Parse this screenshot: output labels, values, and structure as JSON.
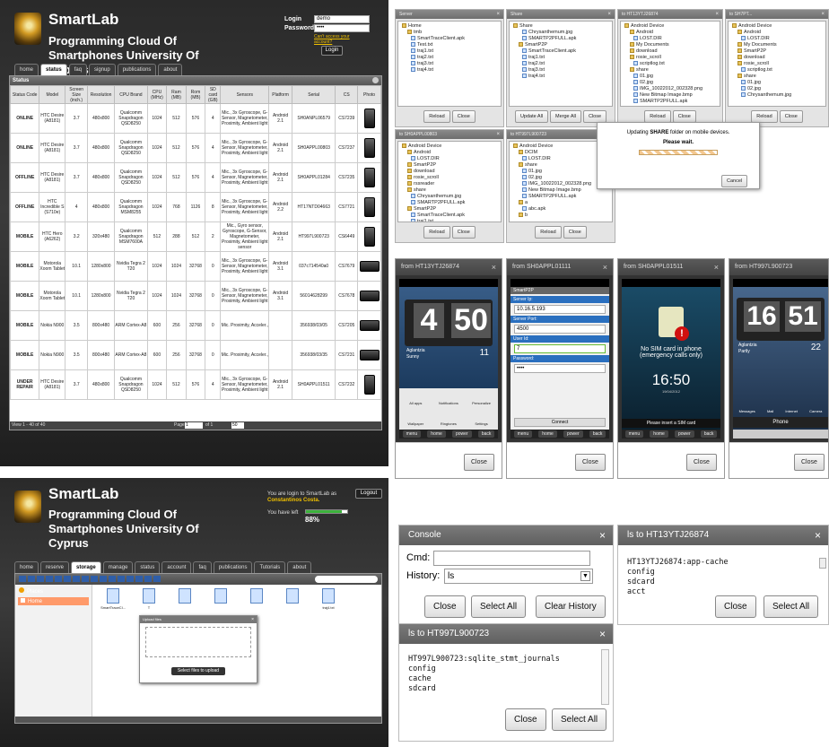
{
  "p1": {
    "app_title": "SmartLab",
    "subtitle": "Programming Cloud Of Smartphones University Of Cyprus",
    "login_label": "Login",
    "login_value": "demo",
    "password_label": "Password",
    "password_value": "••••",
    "access_link": "Can't access your account?",
    "login_button": "Login",
    "tabs": [
      "home",
      "status",
      "faq",
      "signup",
      "publications",
      "about"
    ],
    "panel_title": "Status",
    "columns": [
      "Status Code",
      "Model",
      "Screen Size (inch.)",
      "Resolution",
      "CPU Brand",
      "CPU (MHz)",
      "Ram (MB)",
      "Rom (MB)",
      "SD card (GB)",
      "Sensors",
      "Platform",
      "Serial",
      "CS",
      "Photo"
    ],
    "rows": [
      {
        "status": "ONLINE",
        "model": "HTC Desire (A8181)",
        "size": "3.7",
        "res": "480x800",
        "cpu": "Qualcomm Snapdragon QSD8250",
        "mhz": "1024",
        "ram": "512",
        "rom": "576",
        "sd": "4",
        "sensors": "Mic., 3x Gyroscope, G-Sensor, Magnetometer, Proximity, Ambient light",
        "platform": "Android 2.1",
        "serial": "SH0ANPL06579",
        "cs": "CS7239",
        "photo": "phone"
      },
      {
        "status": "ONLINE",
        "model": "HTC Desire (A8181)",
        "size": "3.7",
        "res": "480x800",
        "cpu": "Qualcomm Snapdragon QSD8250",
        "mhz": "1024",
        "ram": "512",
        "rom": "576",
        "sd": "4",
        "sensors": "Mic., 3x Gyroscope, G-Sensor, Magnetometer, Proximity, Ambient light",
        "platform": "Android 2.1",
        "serial": "SH0APPL00803",
        "cs": "CS7237",
        "photo": "phone"
      },
      {
        "status": "OFFLINE",
        "model": "HTC Desire (A8181)",
        "size": "3.7",
        "res": "480x800",
        "cpu": "Qualcomm Snapdragon QSD8250",
        "mhz": "1024",
        "ram": "512",
        "rom": "576",
        "sd": "4",
        "sensors": "Mic., 3x Gyroscope, G-Sensor, Magnetometer, Proximity, Ambient light",
        "platform": "Android 2.1",
        "serial": "SH0APPL01284",
        "cs": "CS7235",
        "photo": "phone"
      },
      {
        "status": "OFFLINE",
        "model": "HTC Incredible S (S710e)",
        "size": "4",
        "res": "480x800",
        "cpu": "Qualcomm Snapdragon MSM8255",
        "mhz": "1024",
        "ram": "768",
        "rom": "1126",
        "sd": "8",
        "sensors": "Mic., 3x Gyroscope, G-Sensor, Magnetometer, Proximity, Ambient light",
        "platform": "Android 2.2",
        "serial": "HT17NTD04663",
        "cs": "CS7721",
        "photo": "phone"
      },
      {
        "status": "MOBILE",
        "model": "HTC Hero (A6262)",
        "size": "3.2",
        "res": "320x480",
        "cpu": "Qualcomm Snapdragon MSM7600A",
        "mhz": "512",
        "ram": "288",
        "rom": "512",
        "sd": "2",
        "sensors": "Mic., Gyro sensor, Gyroscope, G-Sensor, Magnetometer, Proximity, Ambient light sensor",
        "platform": "Android 2.1",
        "serial": "HT997L900723",
        "cs": "CS6449",
        "photo": "phone"
      },
      {
        "status": "MOBILE",
        "model": "Motorola Xoom Tablet",
        "size": "10.1",
        "res": "1280x800",
        "cpu": "Nvidia Tegra 2 T20",
        "mhz": "1024",
        "ram": "1024",
        "rom": "32768",
        "sd": "0",
        "sensors": "Mic., 3x Gyroscope, G-Sensor, Magnetometer, Proximity, Ambient light",
        "platform": "Android 3.1",
        "serial": "037c714540a0",
        "cs": "CS7679",
        "photo": "tablet"
      },
      {
        "status": "MOBILE",
        "model": "Motorola Xoom Tablet",
        "size": "10.1",
        "res": "1280x800",
        "cpu": "Nvidia Tegra 2 T20",
        "mhz": "1024",
        "ram": "1024",
        "rom": "32768",
        "sd": "0",
        "sensors": "Mic., 3x Gyroscope, G-Sensor, Magnetometer, Proximity, Ambient light",
        "platform": "Android 3.1",
        "serial": "56014628299",
        "cs": "CS7678",
        "photo": "tablet"
      },
      {
        "status": "MOBILE",
        "model": "Nokia N900",
        "size": "3.5",
        "res": "800x480",
        "cpu": "ARM Cortex-A8",
        "mhz": "600",
        "ram": "256",
        "rom": "32768",
        "sd": "0",
        "sensors": "Mic. Proximity, Acceler.,",
        "platform": "",
        "serial": "356938/03/05",
        "cs": "CS7205",
        "photo": "tablet"
      },
      {
        "status": "MOBILE",
        "model": "Nokia N900",
        "size": "3.5",
        "res": "800x480",
        "cpu": "ARM Cortex-A8",
        "mhz": "600",
        "ram": "256",
        "rom": "32768",
        "sd": "0",
        "sensors": "Mic. Proximity, Acceler.,",
        "platform": "",
        "serial": "356938/03/35",
        "cs": "CS7231",
        "photo": "tablet"
      },
      {
        "status": "UNDER REPAIR",
        "model": "HTC Desire (A8181)",
        "size": "3.7",
        "res": "480x800",
        "cpu": "Qualcomm Snapdragon QSD8250",
        "mhz": "1024",
        "ram": "512",
        "rom": "576",
        "sd": "4",
        "sensors": "Mic., 3x Gyroscope, G-Sensor, Magnetometer, Proximity, Ambient light",
        "platform": "Android 2.1",
        "serial": "SH0APPL01511",
        "cs": "CS7232",
        "photo": "phone"
      }
    ],
    "footer_left": "View 1 - 40 of 40",
    "page_label": "Page",
    "page_value": "1",
    "page_of": "of 1",
    "rows_select": "50"
  },
  "p2": {
    "windows": [
      {
        "title": "Server",
        "items": [
          "Home",
          "tmb",
          "SmartTraceClient.apk",
          "Test.txt",
          "traj1.txt",
          "traj2.txt",
          "traj3.txt",
          "traj4.txt"
        ],
        "buttons": [
          "Reload",
          "Close"
        ]
      },
      {
        "title": "Share",
        "items": [
          "Share",
          "Chrysanthemum.jpg",
          "SMARTP2PFULL.apk",
          "SmartP2P",
          "SmartTraceClient.apk",
          "traj1.txt",
          "traj2.txt",
          "traj3.txt",
          "traj4.txt"
        ],
        "buttons": [
          "Update All",
          "Merge All",
          "Close"
        ]
      },
      {
        "title": "to HT13YTJ26874",
        "items": [
          "Android Device",
          "Android",
          "LOST.DIR",
          "My Documents",
          "download",
          "rosie_scroll",
          "scriptlog.txt",
          "share",
          "01.jpg",
          "02.jpg",
          "IMG_10022012_002328.png",
          "New Bitmap Image.bmp",
          "SMARTP2PFULL.apk"
        ],
        "buttons": [
          "Reload",
          "Close"
        ]
      },
      {
        "title": "to SH7PT...",
        "items": [
          "Android Device",
          "Android",
          "LOST.DIR",
          "My Documents",
          "SmartP2P",
          "download",
          "rosie_scroll",
          "scriptlog.txt",
          "share",
          "01.jpg",
          "02.jpg",
          "Chrysanthemum.jpg"
        ],
        "buttons": [
          "Reload",
          "Close"
        ]
      },
      {
        "title": "to SH0APPL00803",
        "items": [
          "Android Device",
          "Android",
          "LOST.DIR",
          "SmartP2P",
          "download",
          "rosie_scroll",
          "rssreader",
          "share",
          "Chrysanthemum.jpg",
          "SMARTP2PFULL.apk",
          "SmartP2P",
          "SmartTraceClient.apk",
          "traj1.txt"
        ],
        "buttons": [
          "Reload",
          "Close"
        ]
      },
      {
        "title": "to HT997L900723",
        "items": [
          "Android Device",
          "DCIM",
          "LOST.DIR",
          "share",
          "01.jpg",
          "02.jpg",
          "IMG_10022012_002328.png",
          "New Bitmap Image.bmp",
          "SMARTP2PFULL.apk",
          "a",
          "abc.apk",
          "b"
        ],
        "buttons": [
          "Reload",
          "Close"
        ]
      }
    ],
    "dialog_text_pre": "Updating ",
    "dialog_text_bold": "SHARE",
    "dialog_text_post": " folder on mobile devices.",
    "dialog_wait": "Please wait.",
    "dialog_cancel": "Cancel"
  },
  "p3": {
    "screens": [
      {
        "title": "from HT13YTJ26874",
        "clock_h": "4",
        "clock_m": "50",
        "city": "Aglantzia",
        "weather": "Sunny",
        "temp": "11",
        "apps": [
          "All apps",
          "Notifications",
          "Personalize",
          "Wallpaper",
          "Ringtones",
          "Settings"
        ]
      },
      {
        "title": "from SH0APPL01111",
        "appname": "SmartP2P",
        "server_ip_label": "Server Ip:",
        "server_ip": "10.16.5.193",
        "server_port_label": "Server Port:",
        "server_port": "4500",
        "user_id_label": "User Id:",
        "user_id": "7",
        "password_label": "Password:",
        "password": "••••",
        "connect": "Connect"
      },
      {
        "title": "from SH0APPL01511",
        "sim_text": "No SIM card in phone (emergency calls only)",
        "clock": "16:50",
        "date": "19/04/2012",
        "insert_sim": "Please insert a SIM card"
      },
      {
        "title": "from HT997L900723",
        "clock_h": "16",
        "clock_m": "51",
        "city": "Aglantzia",
        "weather": "Partly",
        "temp": "22",
        "dock": [
          "Messages",
          "Mail",
          "Internet",
          "Camera"
        ],
        "phone_label": "Phone"
      }
    ],
    "nav": [
      "menu",
      "home",
      "power",
      "back"
    ],
    "close_label": "Close"
  },
  "p4": {
    "app_title": "SmartLab",
    "subtitle": "Programming Cloud Of Smartphones University Of Cyprus",
    "login_msg_pre": "You are login to SmartLab as",
    "login_user": "Constantinos Costa.",
    "logout": "Logout",
    "time_left_label": "You have left",
    "time_left_value": "88%",
    "time_left_fraction": 0.88,
    "tabs": [
      "home",
      "reserve",
      "storage",
      "manage",
      "status",
      "account",
      "faq",
      "publications",
      "Tutorials",
      "about"
    ],
    "active_tab": "storage",
    "places_label": "Places",
    "home_place": "Home",
    "files": [
      "SmartTraceCl...",
      "T",
      "",
      "",
      "",
      "",
      "traj4.txt"
    ],
    "upload_title": "Upload files",
    "drop_text": "Drop files here",
    "or_text": "or",
    "select_button": "Select files to upload"
  },
  "p5": {
    "console_title": "Console",
    "cmd_label": "Cmd:",
    "cmd_value": "",
    "history_label": "History:",
    "history_value": "ls",
    "console_buttons": [
      "Close",
      "Select All",
      "Clear History"
    ],
    "ls1_title": "ls to HT13YTJ26874",
    "ls1_output": "HT13YTJ26874:app-cache\nconfig\nsdcard\nacct",
    "ls1_buttons": [
      "Close",
      "Select All"
    ],
    "ls2_title": "ls to HT997L900723",
    "ls2_output": "HT997L900723:sqlite_stmt_journals\nconfig\ncache\nsdcard",
    "ls2_buttons": [
      "Close",
      "Select All"
    ]
  },
  "colors": {
    "online": "#3a9a2a",
    "offline": "#d01010",
    "mobile": "#2040b0",
    "under_repair": "#e0a000",
    "accent": "#f0c000"
  }
}
